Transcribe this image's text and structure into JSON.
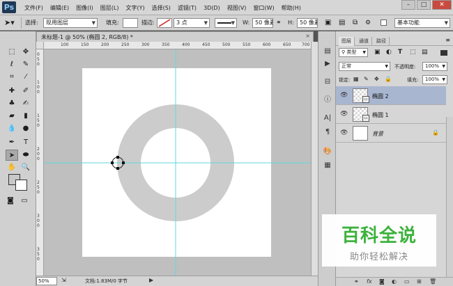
{
  "app": {
    "logo": "Ps"
  },
  "menu": [
    "文件(F)",
    "编辑(E)",
    "图像(I)",
    "图层(L)",
    "文字(Y)",
    "选择(S)",
    "滤镜(T)",
    "3D(D)",
    "视图(V)",
    "窗口(W)",
    "帮助(H)"
  ],
  "options_bar": {
    "select_label": "选择:",
    "select_value": "现用图层",
    "fill_label": "填充:",
    "stroke_label": "描边:",
    "stroke_size": "3 点",
    "w_label": "W:",
    "w_value": "50 像素",
    "h_label": "H:",
    "h_value": "50 像素",
    "workspace": "基本功能"
  },
  "document": {
    "tab_title": "未标题-1 @ 50% (椭圆 2, RGB/8) *",
    "tab_close": "×",
    "ruler_top_labels": [
      "100",
      "150",
      "200",
      "250",
      "300",
      "350",
      "400",
      "450",
      "500",
      "550",
      "600",
      "650",
      "700"
    ],
    "ruler_left_labels": [
      "0",
      "5",
      "0",
      "1",
      "0",
      "0",
      "1",
      "5",
      "0",
      "2",
      "0",
      "0",
      "2",
      "5",
      "0",
      "3",
      "0",
      "0",
      "3",
      "5",
      "0"
    ],
    "zoom": "50%",
    "info": "文档:1.83M/0 字节"
  },
  "layers_panel": {
    "tabs": [
      "图层",
      "通道",
      "路径"
    ],
    "filter_kind": "类型",
    "blend_mode": "正常",
    "opacity_label": "不透明度:",
    "opacity_value": "100%",
    "lock_label": "锁定:",
    "fill_label": "填充:",
    "fill_value": "100%",
    "layers": [
      {
        "name": "椭圆 2",
        "selected": true
      },
      {
        "name": "椭圆 1",
        "selected": false
      },
      {
        "name": "背景",
        "selected": false,
        "locked": true
      }
    ]
  },
  "watermark": {
    "title": "百科全说",
    "subtitle": "助你轻松解决"
  },
  "colors": {
    "ring": "#cccccc",
    "guide": "#5fd7e0",
    "selected_layer": "#a9b6cf",
    "watermark_green": "#3cb23c"
  }
}
